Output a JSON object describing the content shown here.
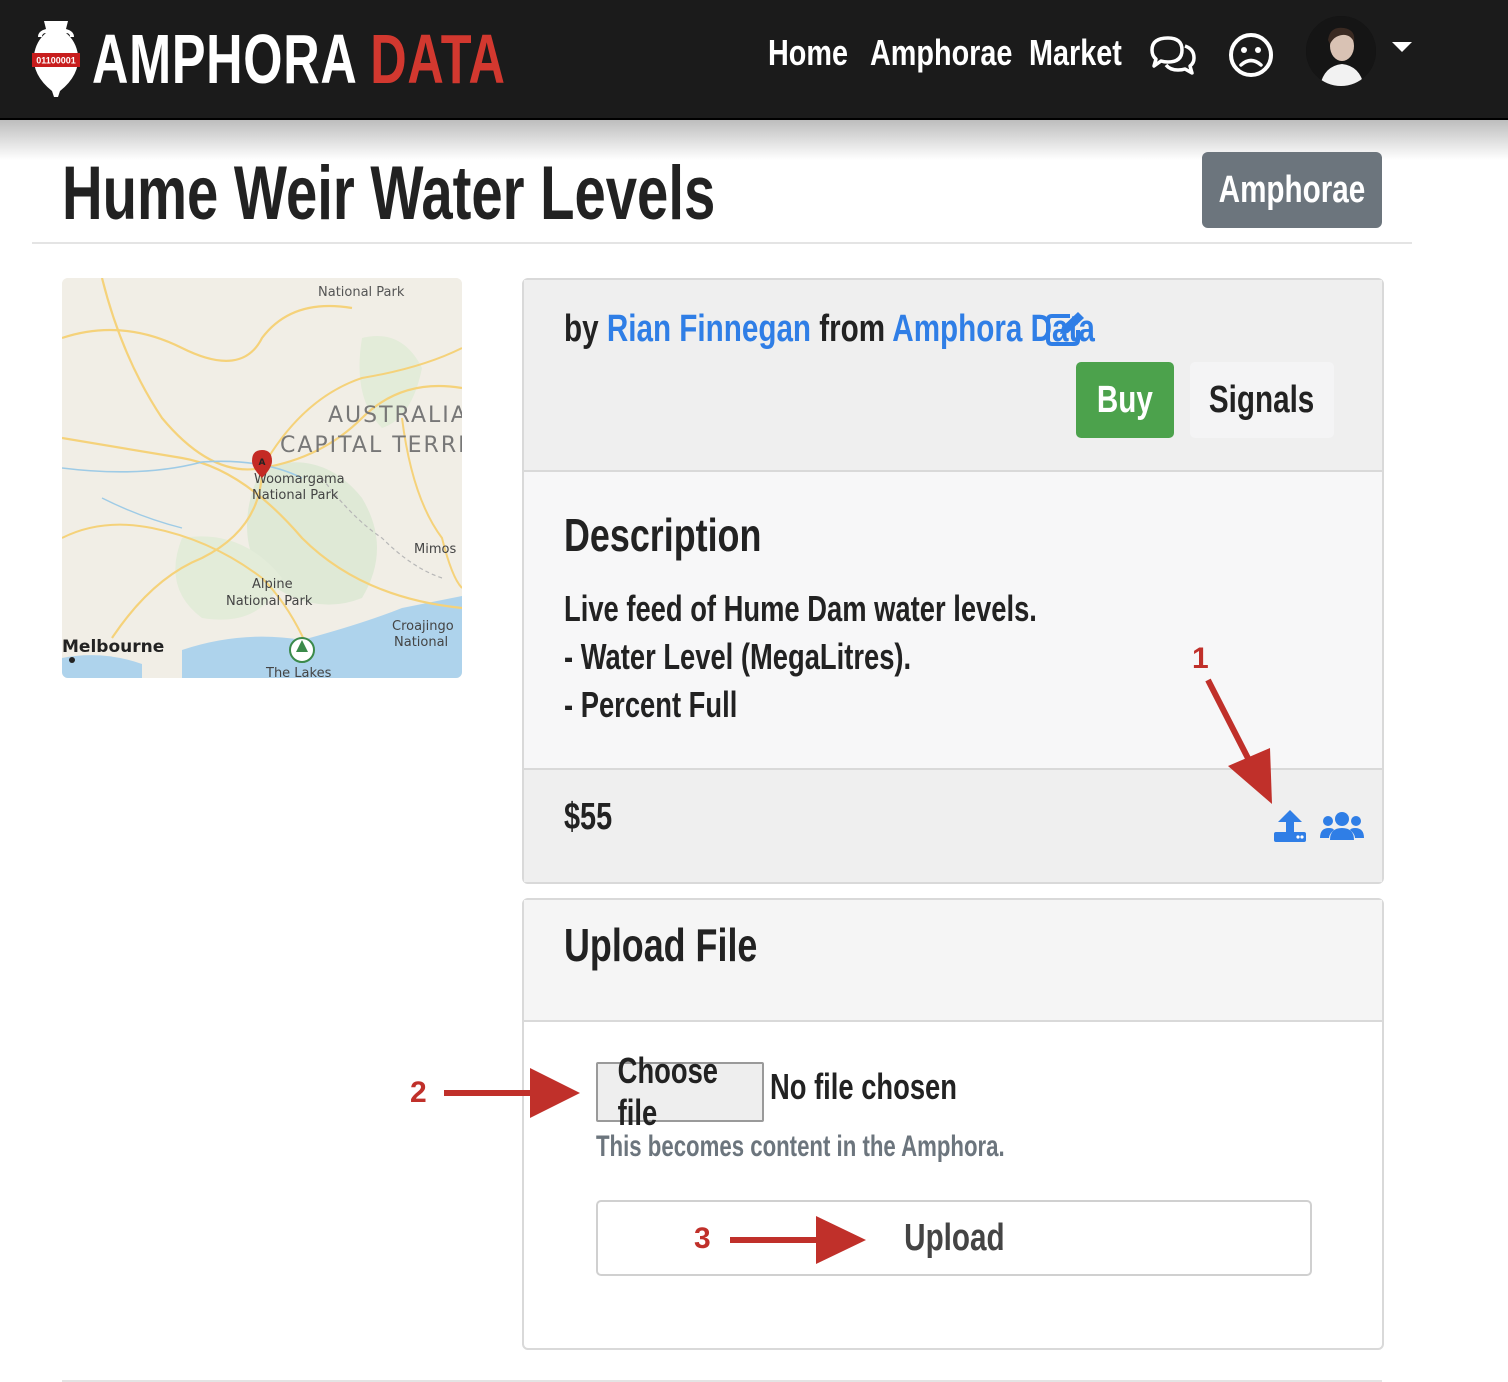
{
  "navbar": {
    "brand_logo_text": "01100001",
    "brand_main": "AMPHORA",
    "brand_accent": "DATA",
    "links": [
      "Home",
      "Amphorae",
      "Market"
    ],
    "icons": [
      "chat-icon",
      "frown-icon"
    ],
    "user_avatar": "avatar"
  },
  "header": {
    "title": "Hume Weir Water Levels",
    "amphorae_button": "Amphorae"
  },
  "map": {
    "labels": [
      "National Park",
      "AUSTRALIA",
      "CAPITAL TERRI",
      "Woomargama",
      "National Park",
      "Alpine",
      "National Park",
      "Melbourne",
      "Mimos",
      "Croajingo",
      "National",
      "The Lakes"
    ],
    "pin_label": "A"
  },
  "product_card": {
    "by": "by",
    "author": "Rian Finnegan",
    "from": "from",
    "organisation": "Amphora Data",
    "buy_button": "Buy",
    "signals_button": "Signals",
    "description_heading": "Description",
    "description_lines": [
      "Live feed of Hume Dam water levels.",
      "- Water Level (MegaLitres).",
      "- Percent Full"
    ],
    "price": "$55"
  },
  "upload_card": {
    "heading": "Upload File",
    "choose_file_button": "Choose file",
    "file_status": "No file chosen",
    "help_text": "This becomes content in the Amphora.",
    "upload_button": "Upload"
  },
  "annotations": [
    "1",
    "2",
    "3"
  ],
  "colors": {
    "navbar_bg": "#1b1b1b",
    "brand_accent": "#d2382f",
    "link_blue": "#2f7ee6",
    "buy_green": "#4ca24c",
    "secondary_gray": "#6c757d",
    "arrow_red": "#c0302a"
  }
}
